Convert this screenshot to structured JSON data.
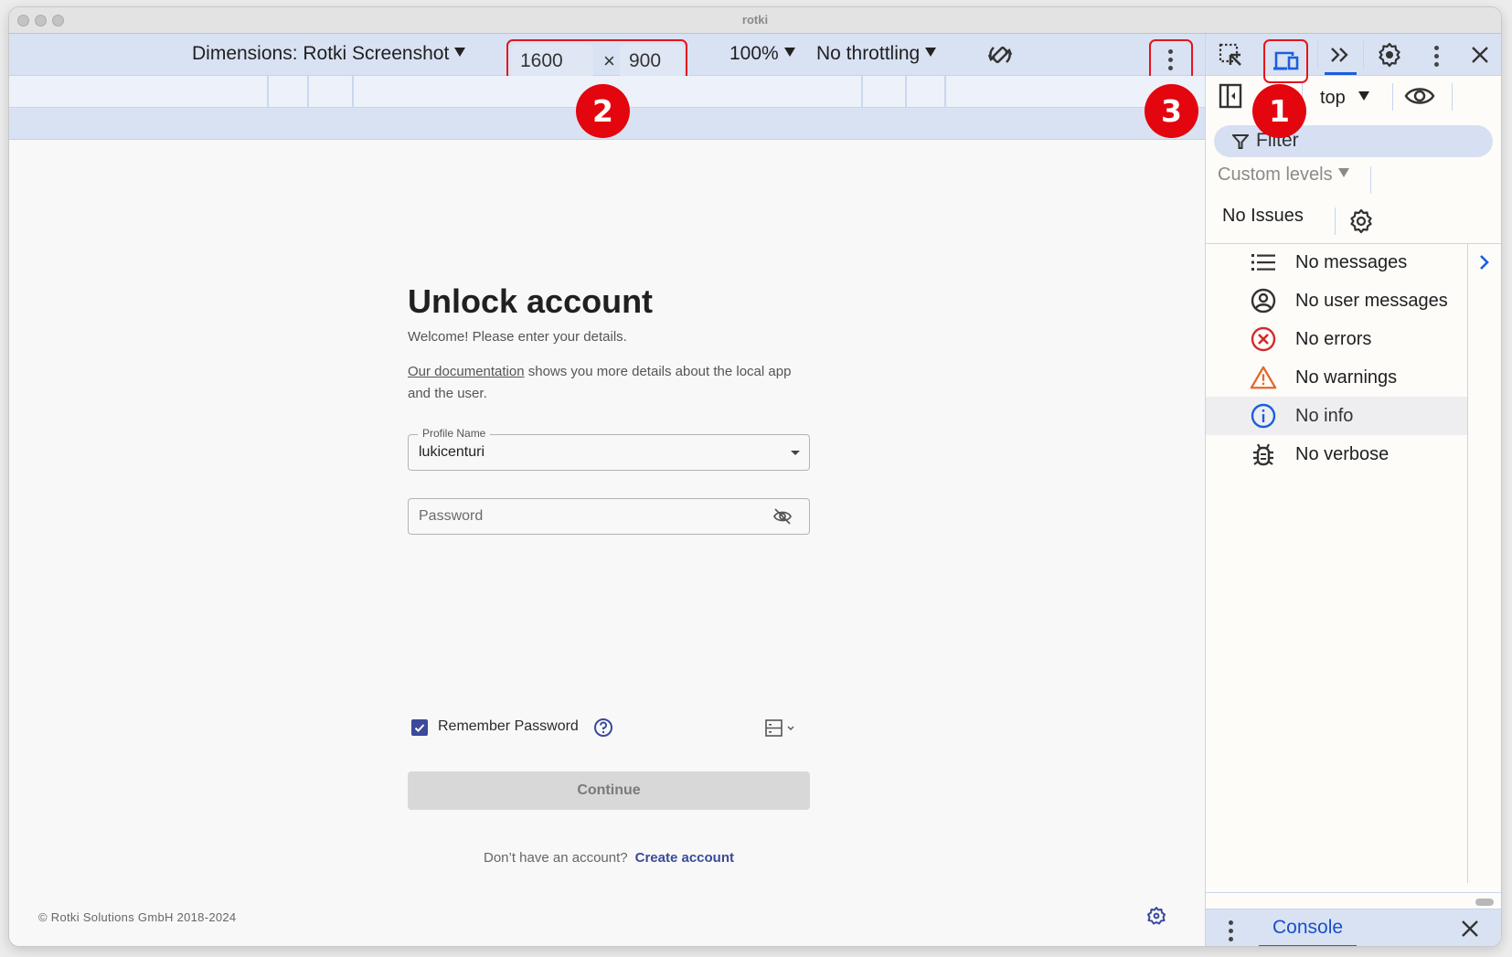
{
  "window": {
    "title": "rotki"
  },
  "device_toolbar": {
    "dimensions_label": "Dimensions: Rotki Screenshot",
    "width_value": "1600",
    "times_sign": "×",
    "height_value": "900",
    "zoom": "100%",
    "throttling": "No throttling"
  },
  "annotations": {
    "badge_1": "1",
    "badge_2": "2",
    "badge_3": "3"
  },
  "login": {
    "title": "Unlock account",
    "welcome": "Welcome! Please enter your details.",
    "docs_link": "Our documentation",
    "docs_text": " shows you more details about the local app and the user.",
    "profile_label": "Profile Name",
    "profile_value": "lukicenturi",
    "password_placeholder": "Password",
    "password_value": "",
    "remember_label": "Remember Password",
    "remember_checked": true,
    "continue_label": "Continue",
    "no_account_text": "Don’t have an account?",
    "create_account_label": "Create account"
  },
  "footer": {
    "copyright": "© Rotki Solutions GmbH 2018-2024"
  },
  "devtools": {
    "context": "top",
    "filter_placeholder": "Filter",
    "levels_label": "Custom levels",
    "issues_label": "No Issues",
    "messages": [
      {
        "icon": "list-icon",
        "label": "No messages"
      },
      {
        "icon": "user-circle-icon",
        "label": "No user messages"
      },
      {
        "icon": "error-icon",
        "label": "No errors"
      },
      {
        "icon": "warning-icon",
        "label": "No warnings"
      },
      {
        "icon": "info-icon",
        "label": "No info",
        "selected": true
      },
      {
        "icon": "bug-icon",
        "label": "No verbose"
      }
    ],
    "drawer_tab": "Console"
  },
  "colors": {
    "accent": "#3b4a9a",
    "devtools_blue": "#1a5ee0",
    "annotation_red": "#e3060e",
    "error_red": "#d32b2b",
    "warning_orange": "#e5672a",
    "info_blue": "#1a5ee0"
  }
}
